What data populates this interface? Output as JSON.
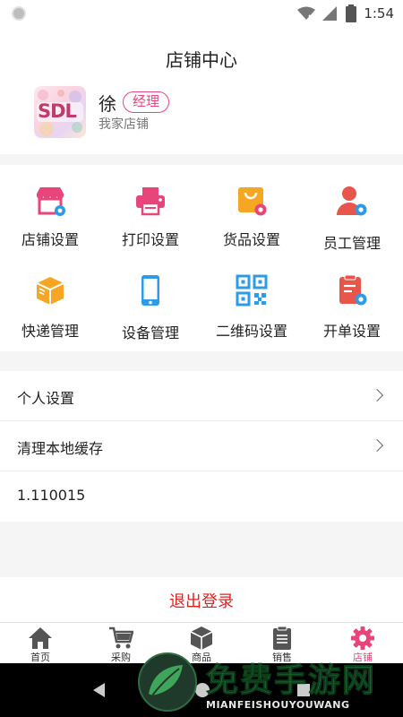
{
  "status_bar": {
    "time": "1:54"
  },
  "header": {
    "title": "店铺中心"
  },
  "profile": {
    "avatar_text": "SDL",
    "name": "徐",
    "role": "经理",
    "store": "我家店铺"
  },
  "grid": [
    {
      "label": "店铺设置",
      "icon": "store-settings-icon"
    },
    {
      "label": "打印设置",
      "icon": "printer-icon"
    },
    {
      "label": "货品设置",
      "icon": "goods-settings-icon"
    },
    {
      "label": "员工管理",
      "icon": "staff-icon"
    },
    {
      "label": "快递管理",
      "icon": "parcel-icon"
    },
    {
      "label": "设备管理",
      "icon": "phone-device-icon"
    },
    {
      "label": "二维码设置",
      "icon": "qrcode-icon"
    },
    {
      "label": "开单设置",
      "icon": "order-settings-icon"
    }
  ],
  "menu": {
    "personal_settings": "个人设置",
    "clear_cache": "清理本地缓存",
    "version": "1.110015"
  },
  "logout": {
    "label": "退出登录"
  },
  "tabs": [
    {
      "label": "首页",
      "icon": "home-icon"
    },
    {
      "label": "采购",
      "icon": "cart-icon"
    },
    {
      "label": "商品",
      "icon": "box-icon"
    },
    {
      "label": "销售",
      "icon": "clipboard-icon"
    },
    {
      "label": "店铺",
      "icon": "gear-icon"
    }
  ],
  "watermark": {
    "title": "免费手游网",
    "subtitle": "MIANFEISHOUYOUWANG"
  },
  "colors": {
    "accent": "#e8457a",
    "logout": "#e02020",
    "blue": "#2d9be8",
    "orange": "#f5a623"
  }
}
